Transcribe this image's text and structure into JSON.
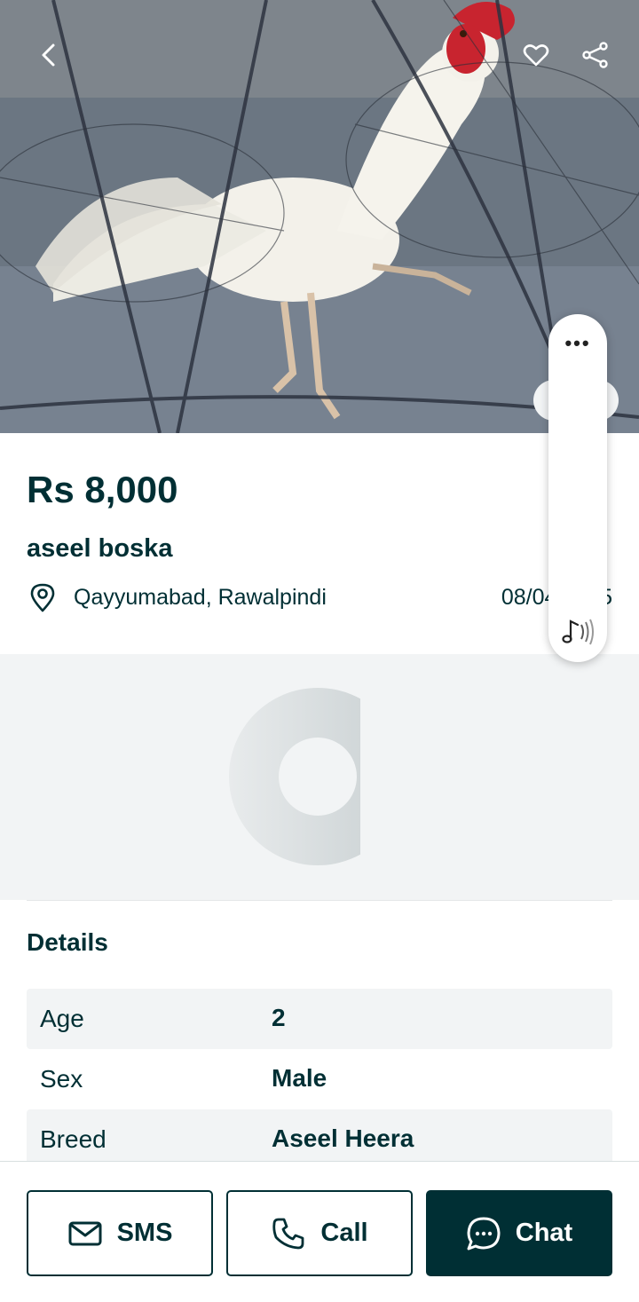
{
  "header": {
    "back_icon": "chevron-left-icon",
    "favorite_icon": "heart-icon",
    "share_icon": "share-icon"
  },
  "listing": {
    "price": "Rs 8,000",
    "title": "aseel boska",
    "location": "Qayyumabad, Rawalpindi",
    "date": "08/04/2025"
  },
  "overlay": {
    "menu_label": "•••",
    "audio_icon": "music-audio-icon"
  },
  "details": {
    "heading": "Details",
    "rows": [
      {
        "key": "Age",
        "value": "2"
      },
      {
        "key": "Sex",
        "value": "Male"
      },
      {
        "key": "Breed",
        "value": "Aseel Heera"
      }
    ]
  },
  "actions": {
    "sms_label": "SMS",
    "call_label": "Call",
    "chat_label": "Chat"
  },
  "colors": {
    "primary": "#002f34",
    "panel_bg": "#f2f4f5"
  }
}
